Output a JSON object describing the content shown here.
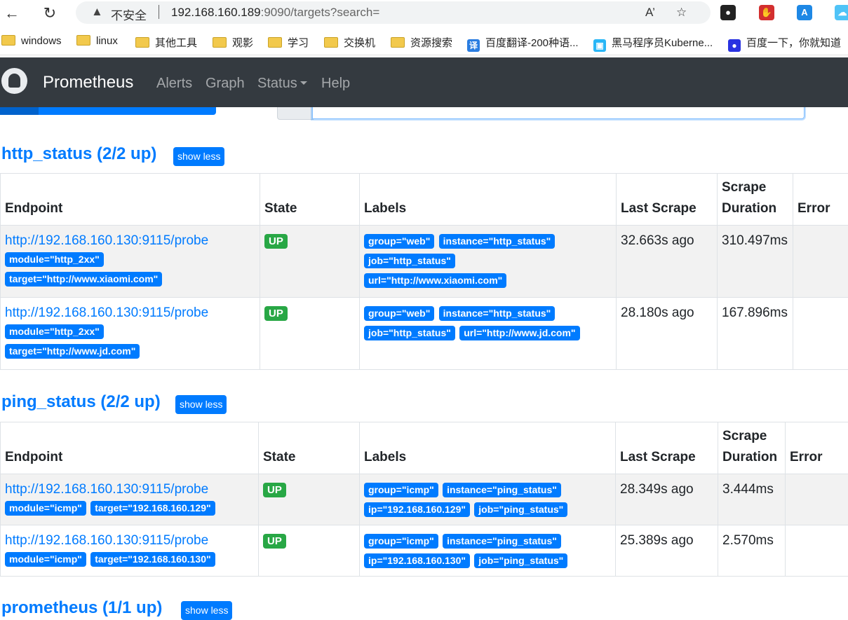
{
  "browser": {
    "warning_text": "不安全",
    "url_host": "192.168.160.189",
    "url_rest": ":9090/targets?search=",
    "bookmarks": [
      "windows",
      "linux",
      "其他工具",
      "观影",
      "学习",
      "交换机",
      "资源搜索",
      "百度翻译-200种语...",
      "黑马程序员Kuberne...",
      "百度一下，你就知道"
    ]
  },
  "navbar": {
    "brand": "Prometheus",
    "links": [
      "Alerts",
      "Graph",
      "Status",
      "Help"
    ]
  },
  "table_headers": {
    "endpoint": "Endpoint",
    "state": "State",
    "labels": "Labels",
    "last_scrape": "Last Scrape",
    "scrape_duration": "Scrape Duration",
    "error": "Error"
  },
  "show_less_label": "show less",
  "sections": [
    {
      "title": "http_status (2/2 up)",
      "rows": [
        {
          "endpoint": "http://192.168.160.130:9115/probe",
          "params": [
            "module=\"http_2xx\"",
            "target=\"http://www.xiaomi.com\""
          ],
          "state": "UP",
          "labels": [
            "group=\"web\"",
            "instance=\"http_status\"",
            "job=\"http_status\"",
            "url=\"http://www.xiaomi.com\""
          ],
          "last_scrape": "32.663s ago",
          "duration": "310.497ms",
          "error": ""
        },
        {
          "endpoint": "http://192.168.160.130:9115/probe",
          "params": [
            "module=\"http_2xx\"",
            "target=\"http://www.jd.com\""
          ],
          "state": "UP",
          "labels": [
            "group=\"web\"",
            "instance=\"http_status\"",
            "job=\"http_status\"",
            "url=\"http://www.jd.com\""
          ],
          "last_scrape": "28.180s ago",
          "duration": "167.896ms",
          "error": ""
        }
      ]
    },
    {
      "title": "ping_status (2/2 up)",
      "rows": [
        {
          "endpoint": "http://192.168.160.130:9115/probe",
          "params": [
            "module=\"icmp\"",
            "target=\"192.168.160.129\""
          ],
          "state": "UP",
          "labels": [
            "group=\"icmp\"",
            "instance=\"ping_status\"",
            "ip=\"192.168.160.129\"",
            "job=\"ping_status\""
          ],
          "last_scrape": "28.349s ago",
          "duration": "3.444ms",
          "error": ""
        },
        {
          "endpoint": "http://192.168.160.130:9115/probe",
          "params": [
            "module=\"icmp\"",
            "target=\"192.168.160.130\""
          ],
          "state": "UP",
          "labels": [
            "group=\"icmp\"",
            "instance=\"ping_status\"",
            "ip=\"192.168.160.130\"",
            "job=\"ping_status\""
          ],
          "last_scrape": "25.389s ago",
          "duration": "2.570ms",
          "error": ""
        }
      ]
    },
    {
      "title": "prometheus (1/1 up)",
      "rows": []
    }
  ]
}
